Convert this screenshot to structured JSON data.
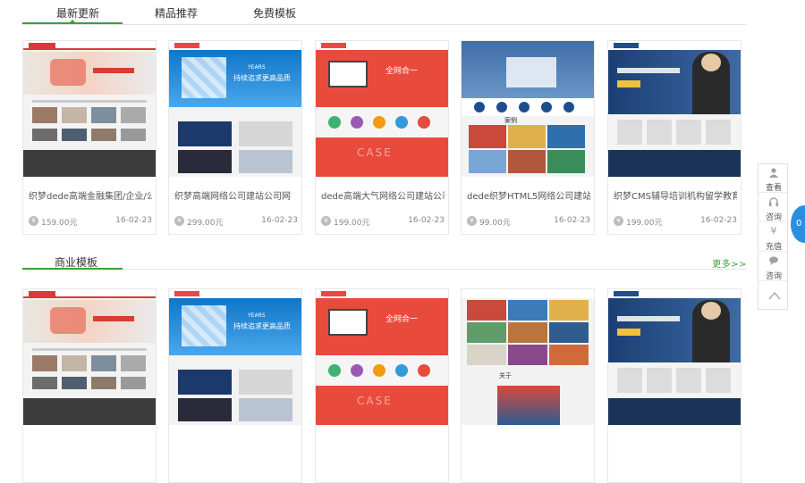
{
  "tabs": [
    "最新更新",
    "精品推荐",
    "免费模板"
  ],
  "section2": {
    "title": "商业模板",
    "more": "更多>>"
  },
  "coin_symbol": "¥",
  "row1": [
    {
      "title": "织梦dede高端金融集团/企业/公",
      "price": "159.00元",
      "date": "16-02-23",
      "theme": "red-grey"
    },
    {
      "title": "织梦高端网络公司建站公司网",
      "price": "299.00元",
      "date": "16-02-23",
      "theme": "blue"
    },
    {
      "title": "dede高端大气网络公司建站公司",
      "price": "199.00元",
      "date": "16-02-23",
      "theme": "red"
    },
    {
      "title": "dede织梦HTML5网络公司建站公司",
      "price": "99.00元",
      "date": "16-02-23",
      "theme": "navy"
    },
    {
      "title": "织梦CMS辅导培训机构留学教育",
      "price": "199.00元",
      "date": "16-02-23",
      "theme": "dark-blue"
    }
  ],
  "row2": [
    {
      "theme": "red-grey"
    },
    {
      "theme": "blue"
    },
    {
      "theme": "red"
    },
    {
      "theme": "mosaic"
    },
    {
      "theme": "dark-blue"
    }
  ],
  "thumb_text": {
    "hero_badge": "YEARS",
    "hero_slogan": "持续追求更高品质",
    "red_slogan": "全网合一",
    "case_label": "CASE",
    "case_cn": "案例",
    "about_label": "关于"
  },
  "sidebar": [
    {
      "label": "查看",
      "icon": "user-icon"
    },
    {
      "label": "咨询",
      "icon": "headset-icon"
    },
    {
      "label": "充值",
      "icon": "yen-icon"
    },
    {
      "label": "咨询",
      "icon": "chat-icon"
    },
    {
      "label": "",
      "icon": "up-arrow-icon"
    }
  ],
  "online_label": "0",
  "colors": {
    "accent": "#3aa13a",
    "red": "#e84a3c",
    "blue": "#1b8ad8",
    "navy": "#1f4e8c"
  }
}
